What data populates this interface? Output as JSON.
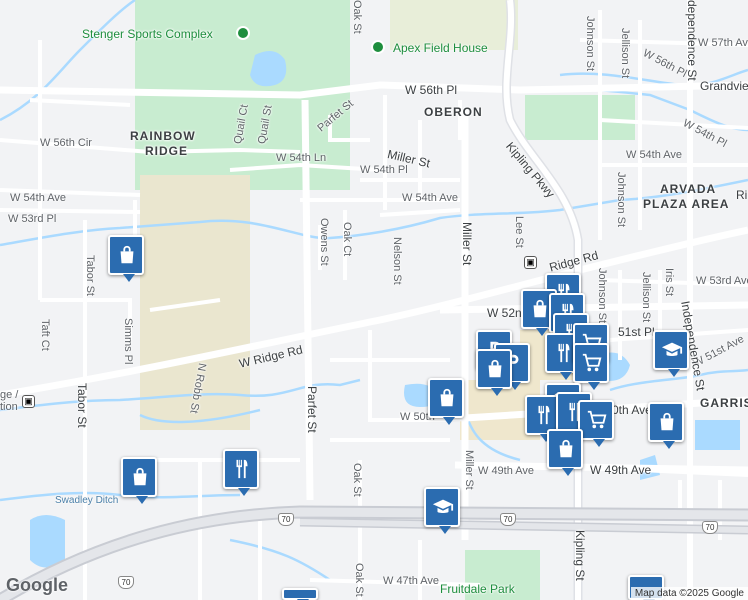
{
  "map": {
    "attribution": "Map data ©2025 Google",
    "logo": "Google",
    "areas": {
      "oberon": "OBERON",
      "rainbow_ridge_1": "RAINBOW",
      "rainbow_ridge_2": "RIDGE",
      "arvada_1": "ARVADA",
      "arvada_2": "PLAZA AREA",
      "garrison": "GARRIS"
    },
    "parks": {
      "stenger": "Stenger Sports Complex",
      "apex": "Apex Field House",
      "fruitdale": "Fruitdale Park"
    },
    "water": {
      "swadley": "Swadley Ditch"
    },
    "roads": {
      "ridge_rd": "W Ridge Rd",
      "ridge_rd_east": "Ridge Rd",
      "w56th_pl": "W 56th Pl",
      "w56th_cir": "W 56th Cir",
      "w54th_ln": "W 54th Ln",
      "w54th_pl": "W 54th Pl",
      "w54th_ave": "W 54th Ave",
      "w54th_ave_west": "W 54th Ave",
      "w54th_ave_east": "W 54th Ave",
      "w53rd_pl": "W 53rd Pl",
      "w53rd_ave": "W 53rd Ave",
      "w52nd": "W 52n",
      "w51st_pl": "51st Pl",
      "w51st_ave": "W 51st Ave",
      "w50th": "W 50th",
      "w50th_east": "0th Ave",
      "w49th_ave": "W 49th Ave",
      "w49th_ave_east": "W 49th Ave",
      "w47th_ave": "W 47th Ave",
      "w57th_ave": "W 57th Ave",
      "w56th_pl_east": "W 56th Pl",
      "w54th_pl_east": "W 54th Pl",
      "grandview": "Grandvie",
      "miller_st": "Miller St",
      "miller_st_v": "Miller St",
      "miller_st_s": "Miller St",
      "kipling": "Kipling Pkwy",
      "kipling_st": "Kipling St",
      "parfet_st": "Parfet St",
      "parfet_st_s": "Parfet St",
      "oak_st": "Oak St",
      "oak_st_s": "Oak St",
      "oak_st_s2": "Oak St",
      "oak_ct": "Oak Ct",
      "owens_st": "Owens St",
      "nelson_st": "Nelson St",
      "lee_st": "Lee St",
      "quail_ct": "Quail Ct",
      "quail_st": "Quail St",
      "tabor_st": "Tabor St",
      "tabor_st_s": "Tabor St",
      "taft_ct": "Taft Ct",
      "simms_pl": "Simms Pl",
      "n_robb_st": "N Robb St",
      "johnson_st": "Johnson St",
      "johnson_st_2": "Johnson St",
      "johnson_st_3": "Johnson St",
      "jellison_st": "Jellison St",
      "jellison_st_2": "Jellison St",
      "iris_st": "Iris St",
      "independence": "dependence St",
      "independence_s": "Independence St",
      "station_frag": "ge /",
      "station_frag2": "tion",
      "ri_frag": "Ri"
    },
    "highway": "70",
    "pin_icons": [
      "shopping-bag-icon",
      "restaurant-icon",
      "graduation-cap-icon",
      "grocery-cart-icon",
      "parking-icon"
    ]
  }
}
